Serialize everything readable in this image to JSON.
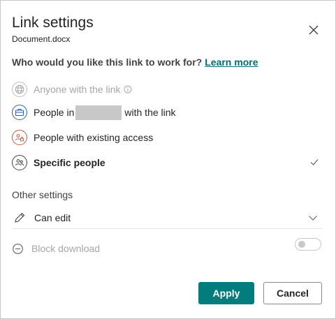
{
  "dialog": {
    "title": "Link settings",
    "subtitle": "Document.docx",
    "question": "Who would you like this link to work for?",
    "learn_more": "Learn more"
  },
  "options": {
    "anyone": {
      "label": "Anyone with the link",
      "icon": "globe-icon",
      "disabled": true
    },
    "org": {
      "label_before": "People in",
      "label_after": "with the link",
      "icon": "organization-icon"
    },
    "existing": {
      "label": "People with existing access",
      "icon": "people-lock-icon"
    },
    "specific": {
      "label": "Specific people",
      "icon": "people-icon",
      "selected": true
    }
  },
  "other_settings": {
    "heading": "Other settings",
    "permission": {
      "value": "Can edit",
      "icon": "pencil-icon"
    },
    "block_download": {
      "label": "Block download",
      "enabled": false
    }
  },
  "buttons": {
    "apply": "Apply",
    "cancel": "Cancel"
  },
  "colors": {
    "accent": "#037c7e",
    "link": "#036c70",
    "org_icon": "#2b63b6",
    "existing_icon": "#c0593f"
  }
}
